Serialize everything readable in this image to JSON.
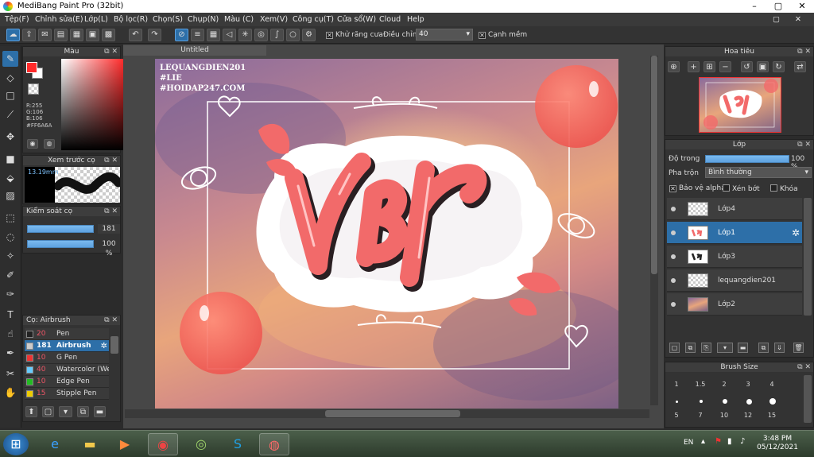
{
  "window": {
    "title": "MediBang Paint Pro (32bit)",
    "min": "–",
    "max": "▢",
    "close": "✕"
  },
  "menu": [
    "Tệp(F)",
    "Chỉnh sửa(E)",
    "Lớp(L)",
    "Bộ lọc(R)",
    "Chọn(S)",
    "Chụp(N)",
    "Màu (C)",
    "Xem(V)",
    "Công cụ(T)",
    "Cửa sổ(W)",
    "Cloud",
    "Help"
  ],
  "menu_extra": {
    "restore": "▢",
    "close": "✕"
  },
  "toolbar": {
    "antialias_label": "Khử răng cưa",
    "adjust_label": "Điều chỉnh",
    "adjust_value": "40",
    "snap_label": "Cạnh mềm"
  },
  "panels": {
    "color": "Màu",
    "preview": "Xem trước cọ",
    "control": "Kiểm soát cọ",
    "brush": "Cọ: Airbrush",
    "navigator": "Hoa tiêu",
    "layer": "Lớp",
    "brush_size": "Brush Size"
  },
  "color": {
    "r": "R:255",
    "g": "G:106",
    "b": "B:106",
    "hex": "#FF6A6A",
    "fg": "#FF2A2A"
  },
  "preview": {
    "size": "13.19mm"
  },
  "control": {
    "size": "181",
    "opacity": "100 %"
  },
  "brushes": [
    {
      "size": "20",
      "name": "Pen",
      "color": "#222222"
    },
    {
      "size": "181",
      "name": "Airbrush",
      "color": "#cccccc",
      "selected": true
    },
    {
      "size": "10",
      "name": "G Pen",
      "color": "#ee3333"
    },
    {
      "size": "40",
      "name": "Watercolor (Wet)",
      "color": "#66ccff"
    },
    {
      "size": "10",
      "name": "Edge Pen",
      "color": "#22bb22"
    },
    {
      "size": "15",
      "name": "Stipple Pen",
      "color": "#eecc00"
    }
  ],
  "canvas": {
    "tab": "Untitled",
    "watermark": [
      "LEQUANGDIEN201",
      "#LIE",
      "#HOIDAP247.COM"
    ]
  },
  "layer": {
    "opacity_label": "Độ trong",
    "opacity_value": "100 %",
    "blend_label": "Pha trộn",
    "blend_value": "Bình thường",
    "protect_alpha": "Bảo vệ alpha",
    "clipping": "Xén bớt",
    "lock": "Khóa",
    "layers": [
      {
        "name": "Lớp4"
      },
      {
        "name": "Lớp1",
        "selected": true
      },
      {
        "name": "Lớp3"
      },
      {
        "name": "lequangdien201"
      },
      {
        "name": "Lớp2"
      }
    ]
  },
  "brush_size": {
    "row1": [
      "1",
      "1.5",
      "2",
      "3",
      "4"
    ],
    "row2": [
      "5",
      "7",
      "10",
      "12",
      "15"
    ]
  },
  "taskbar": {
    "lang": "EN",
    "time": "3:48 PM",
    "date": "05/12/2021"
  }
}
